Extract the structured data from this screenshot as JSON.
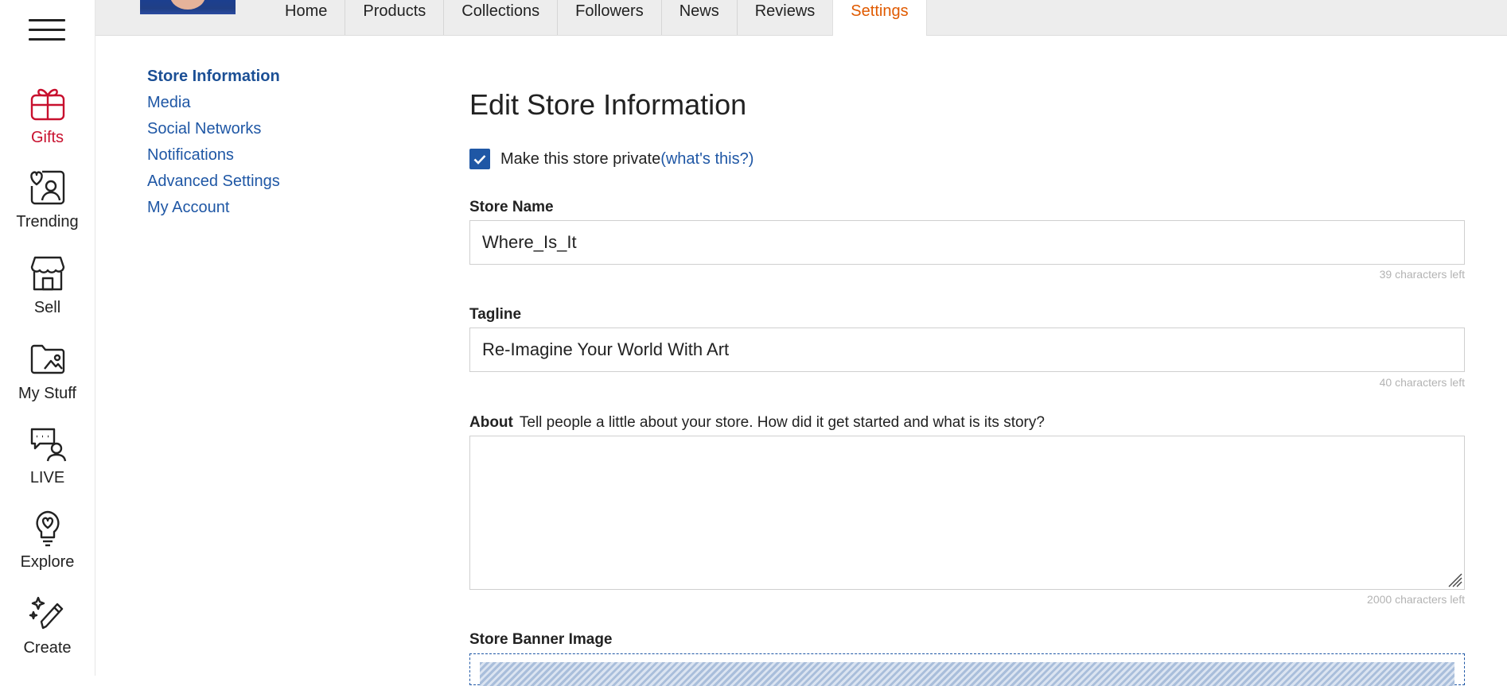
{
  "sidebar": {
    "menu_icon": "hamburger-menu-icon",
    "items": [
      {
        "label": "Gifts",
        "icon": "gift-icon",
        "active": true
      },
      {
        "label": "Trending",
        "icon": "trending-profile-icon"
      },
      {
        "label": "Sell",
        "icon": "storefront-icon"
      },
      {
        "label": "My Stuff",
        "icon": "folder-image-icon"
      },
      {
        "label": "LIVE",
        "icon": "live-chat-person-icon"
      },
      {
        "label": "Explore",
        "icon": "lightbulb-icon"
      },
      {
        "label": "Create",
        "icon": "sparkle-pen-icon"
      }
    ],
    "active_color": "#c8102e"
  },
  "topnav": {
    "tabs": [
      {
        "label": "Home"
      },
      {
        "label": "Products"
      },
      {
        "label": "Collections"
      },
      {
        "label": "Followers"
      },
      {
        "label": "News"
      },
      {
        "label": "Reviews"
      },
      {
        "label": "Settings",
        "active": true
      }
    ],
    "active_color": "#e05a00"
  },
  "settings_nav": {
    "items": [
      {
        "label": "Store Information",
        "active": true
      },
      {
        "label": "Media"
      },
      {
        "label": "Social Networks"
      },
      {
        "label": "Notifications"
      },
      {
        "label": "Advanced Settings"
      },
      {
        "label": "My Account"
      }
    ],
    "link_color": "#1f57a5"
  },
  "form": {
    "title": "Edit Store Information",
    "private_checkbox": {
      "label": "Make this store private",
      "checked": true,
      "help_link": "(what's this?)"
    },
    "store_name": {
      "label": "Store Name",
      "value": "Where_Is_It",
      "chars_left": "39 characters left"
    },
    "tagline": {
      "label": "Tagline",
      "value": "Re-Imagine Your World With Art",
      "chars_left": "40 characters left"
    },
    "about": {
      "label": "About",
      "hint": "Tell people a little about your store. How did it get started and what is its story?",
      "value": "",
      "chars_left": "2000 characters left"
    },
    "banner": {
      "label": "Store Banner Image"
    }
  }
}
